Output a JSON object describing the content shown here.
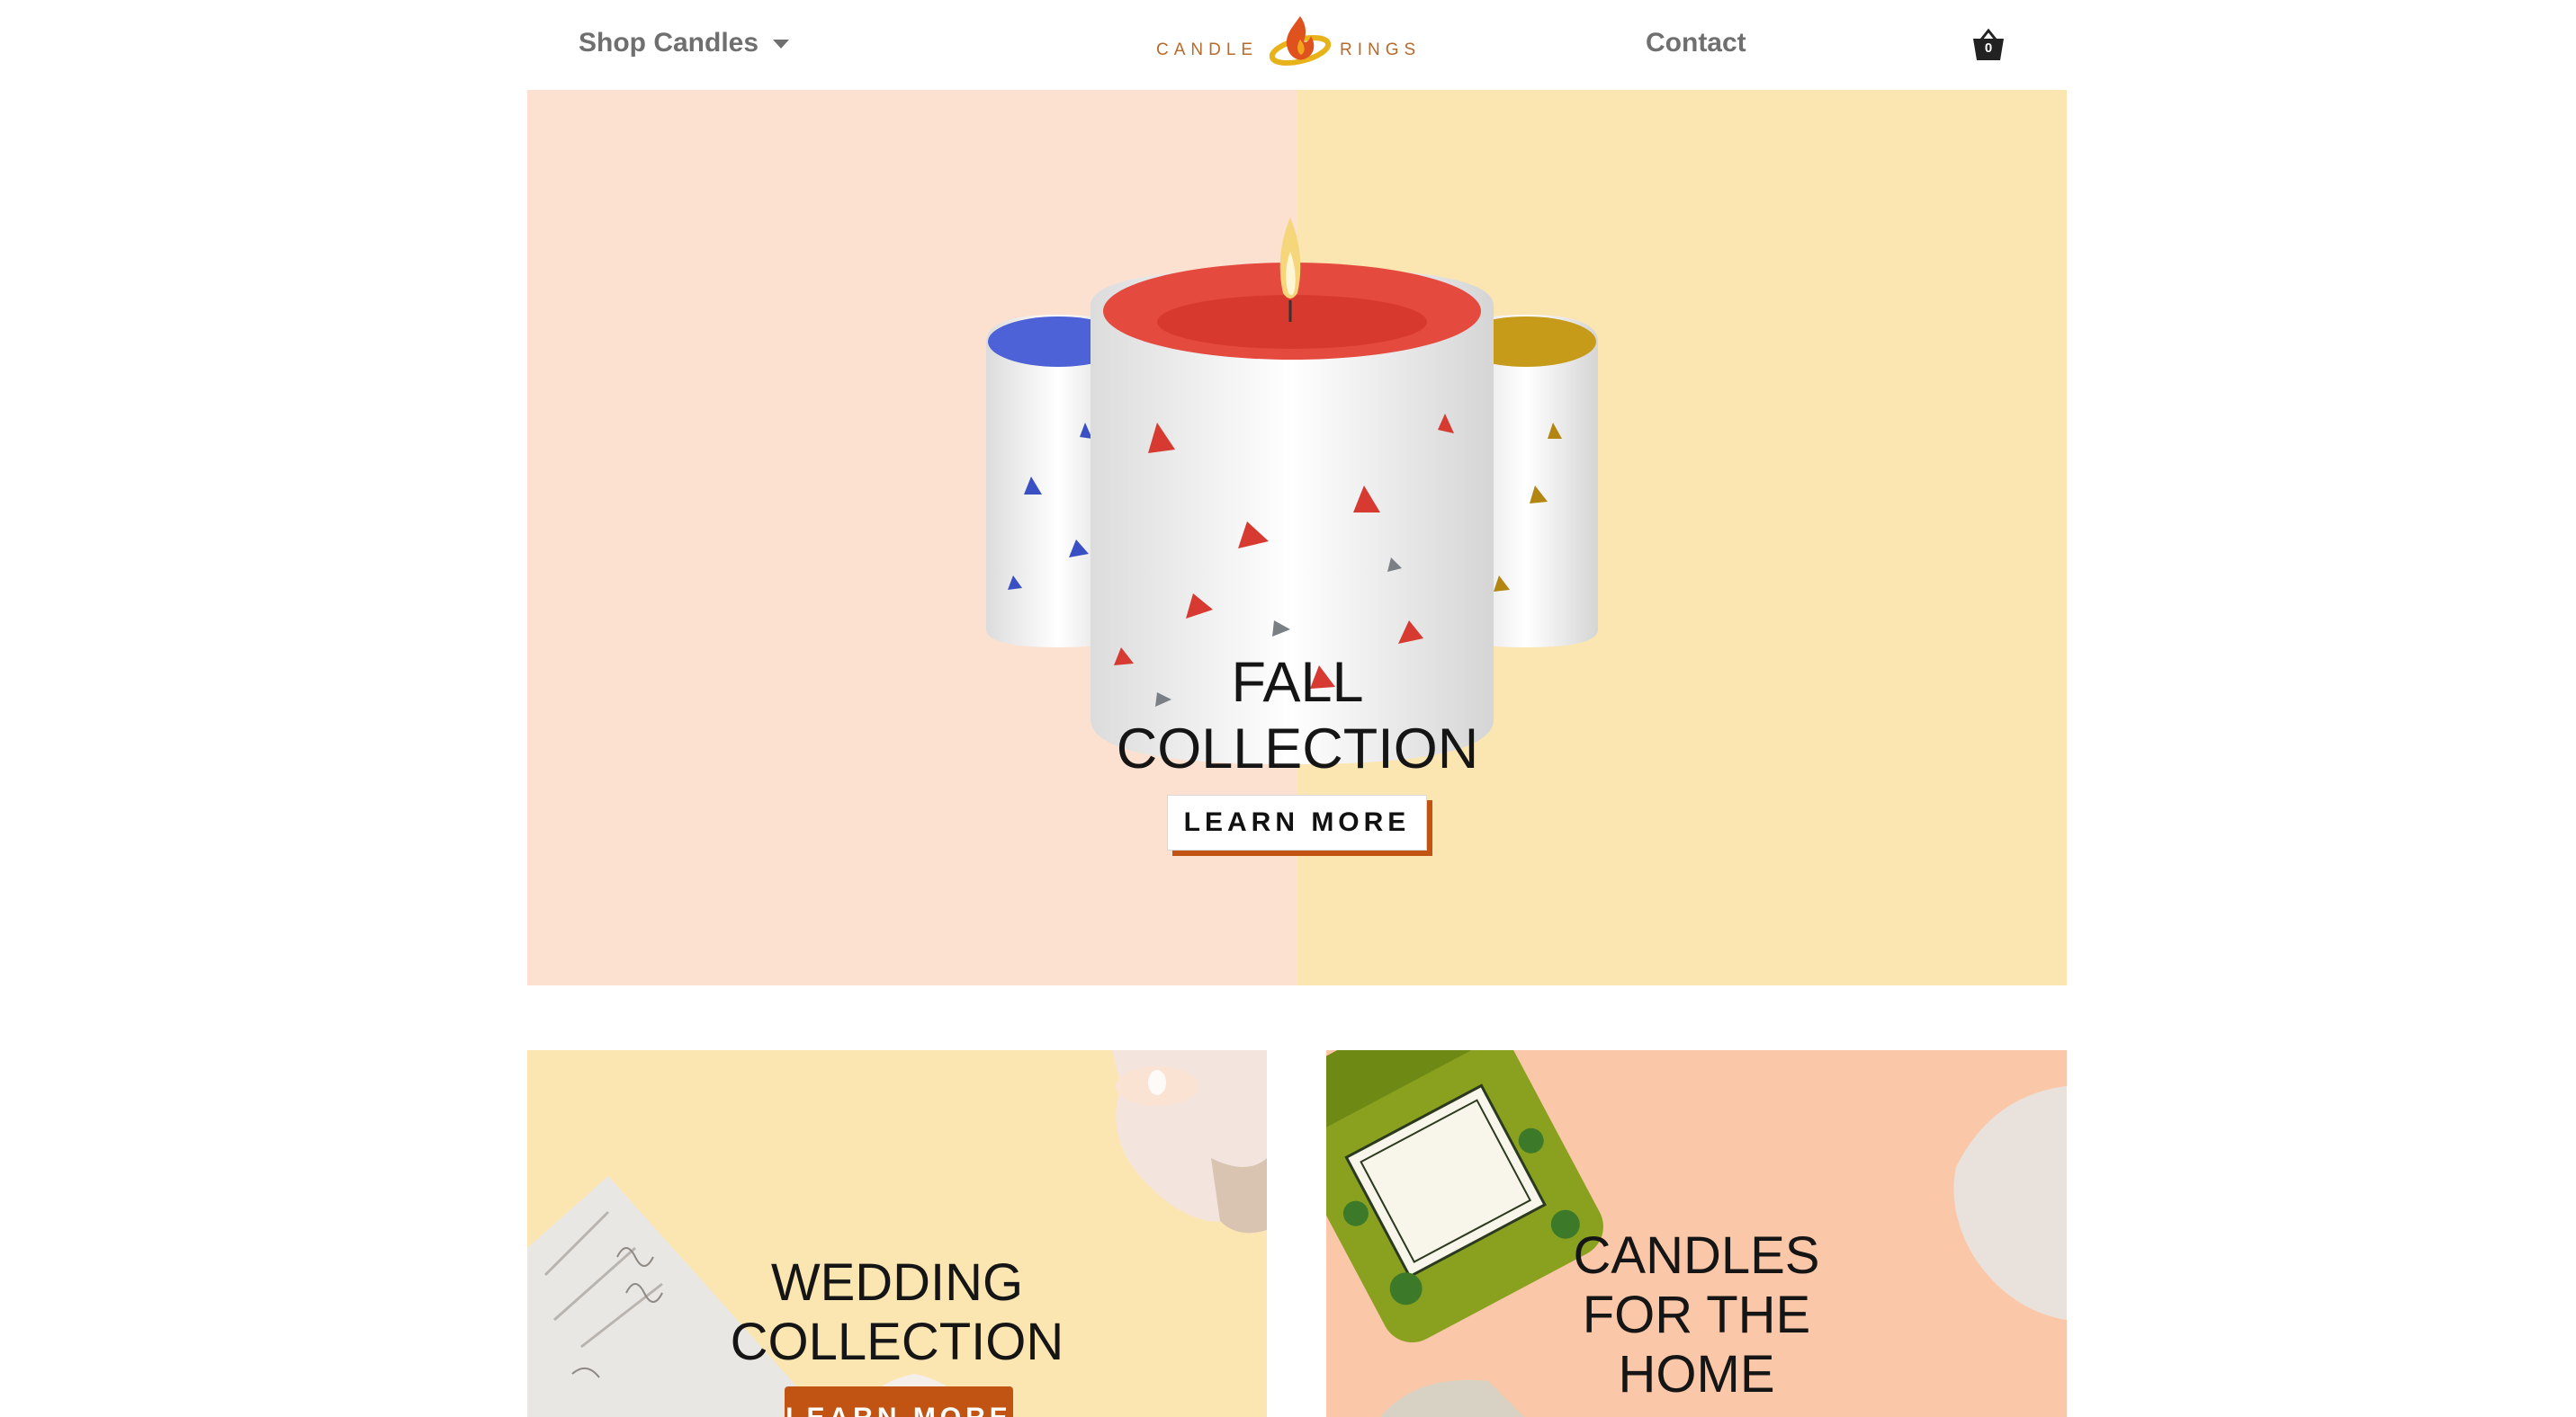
{
  "header": {
    "shop_label": "Shop Candles",
    "logo_left": "CANDLE",
    "logo_right": "RINGS",
    "contact_label": "Contact",
    "cart_count": "0"
  },
  "hero": {
    "title": "FALL\nCOLLECTION",
    "button_label": "LEARN MORE"
  },
  "cards": [
    {
      "title": "WEDDING\nCOLLECTION",
      "button_label": "LEARN MORE"
    },
    {
      "title": "CANDLES\nFOR THE\nHOME"
    }
  ],
  "colors": {
    "accent": "#c25413",
    "peach": "#fde1d0",
    "butter": "#fbe6b2",
    "salmon": "#fac7a9",
    "nav_text": "#6f6f6f"
  }
}
